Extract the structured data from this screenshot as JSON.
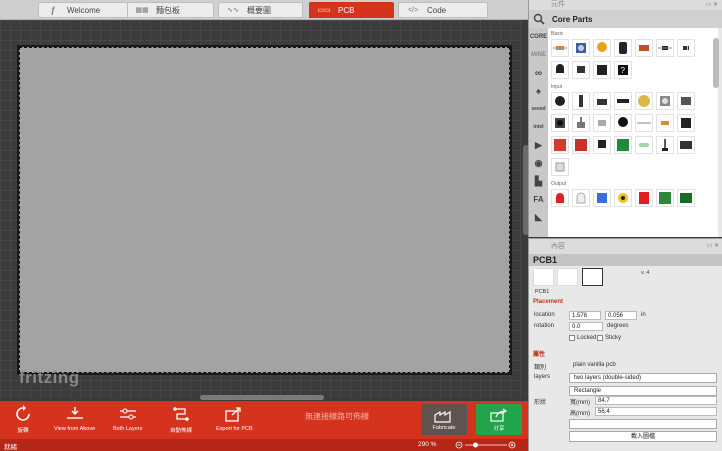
{
  "tabs": [
    {
      "label": "Welcome",
      "icon": "f-icon"
    },
    {
      "label": "麵包板",
      "icon": "breadboard-icon"
    },
    {
      "label": "概要圖",
      "icon": "schematic-icon"
    },
    {
      "label": "PCB",
      "icon": "pcb-icon",
      "active": true
    },
    {
      "label": "Code",
      "icon": "code-icon"
    }
  ],
  "canvas": {
    "logo": "fritzing"
  },
  "toolbar": {
    "rotate": "旋轉",
    "view_from_above": "View from Above",
    "both_layers": "Both Layers",
    "autoroute": "自動佈線",
    "export": "Export for PCB",
    "routing_status": "無連接線路可佈線",
    "fabricate": "Fabricate",
    "share": "分享"
  },
  "status": {
    "text": "就緒",
    "zoom": "290 %",
    "zoom_fraction": 0.25
  },
  "parts": {
    "title": "元件",
    "bin": "Core Parts",
    "bins": [
      "CORE",
      "MINE"
    ],
    "sections": {
      "basic": "Basic",
      "input": "Input",
      "output": "Output"
    }
  },
  "inspector": {
    "title": "內容",
    "name": "PCB1",
    "version": "v. 4",
    "label": "PCB1",
    "placement_title": "Placement",
    "location_label": "location",
    "location_x": "1.578",
    "location_y": "0.056",
    "location_unit": "in",
    "rotation_label": "rotation",
    "rotation": "0.0",
    "rotation_unit": "degrees",
    "locked": "Locked",
    "sticky": "Sticky",
    "props_title": "屬性",
    "family_label": "類別",
    "family": "plain vanilla pcb",
    "layers_label": "layers",
    "layers": "two layers (double-sided)",
    "shape_label": "形狀",
    "shape": "Rectangle",
    "width_label": "寬(mm)",
    "width": "84.7",
    "height_label": "高(mm)",
    "height": "56.4",
    "load_image": "載入圖檔"
  },
  "colors": {
    "accent": "#d5331d",
    "share": "#22a44a",
    "fab": "#5f5350"
  }
}
